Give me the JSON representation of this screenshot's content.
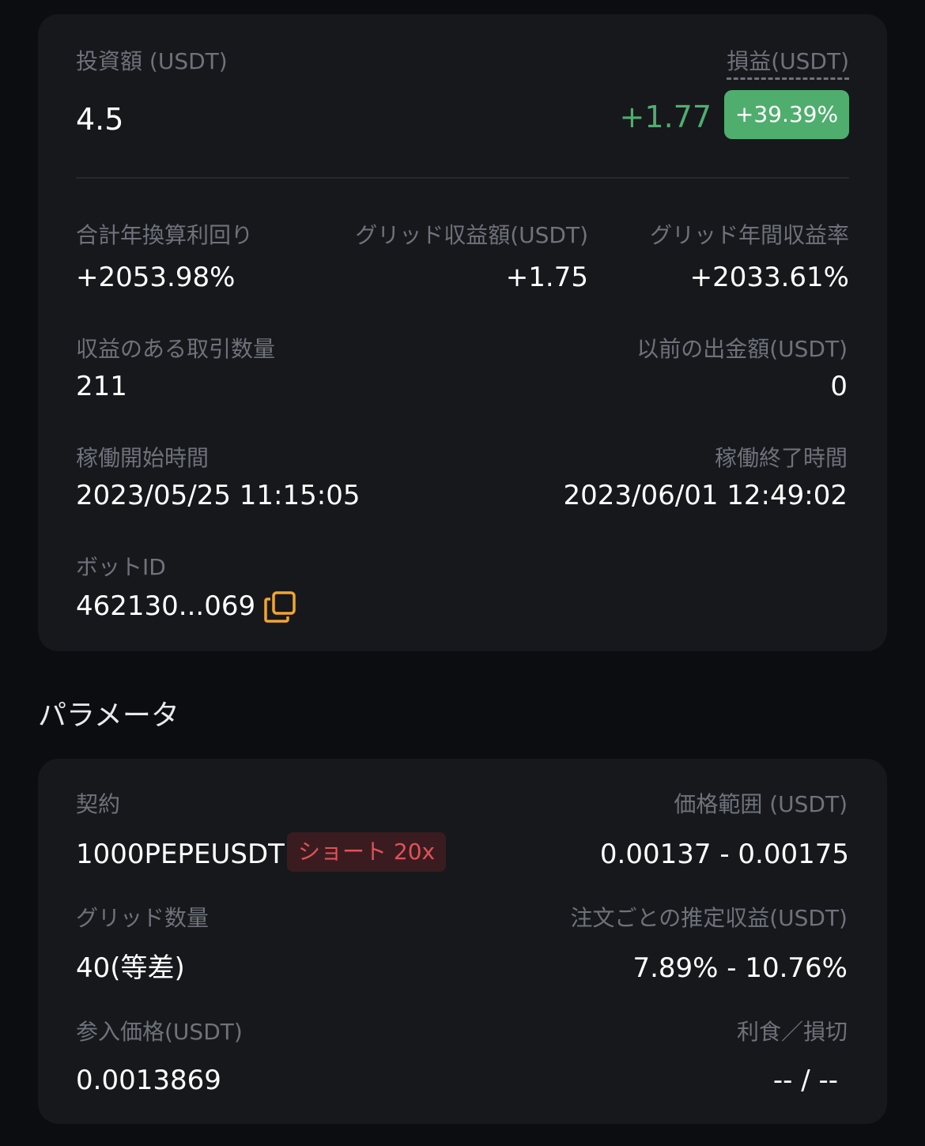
{
  "summary": {
    "investment": {
      "label": "投資額 (USDT)",
      "value": "4.5"
    },
    "pnl": {
      "label": "損益(USDT)",
      "value": "+1.77",
      "percent": "+39.39%"
    },
    "annual_yield": {
      "label": "合計年換算利回り",
      "value": "+2053.98%"
    },
    "grid_profit": {
      "label": "グリッド収益額(USDT)",
      "value": "+1.75"
    },
    "grid_annual_rate": {
      "label": "グリッド年間収益率",
      "value": "+2033.61%"
    },
    "profitable_trades": {
      "label": "収益のある取引数量",
      "value": "211"
    },
    "prev_withdraw": {
      "label": "以前の出金額(USDT)",
      "value": "0"
    },
    "start_time": {
      "label": "稼働開始時間",
      "value": "2023/05/25 11:15:05"
    },
    "end_time": {
      "label": "稼働終了時間",
      "value": "2023/06/01 12:49:02"
    },
    "bot_id": {
      "label": "ボットID",
      "value": "462130...069"
    }
  },
  "params_title": "パラメータ",
  "params": {
    "contract": {
      "label": "契約",
      "value": "1000PEPEUSDT",
      "tag": "ショート 20x"
    },
    "price_range": {
      "label": "価格範囲 (USDT)",
      "value": "0.00137 - 0.00175"
    },
    "grid_count": {
      "label": "グリッド数量",
      "value": "40(等差)"
    },
    "est_profit": {
      "label": "注文ごとの推定収益(USDT)",
      "value": "7.89% - 10.76%"
    },
    "entry_price": {
      "label": "参入価格(USDT)",
      "value": "0.0013869"
    },
    "tp_sl": {
      "label": "利食／損切",
      "value": "-- / --"
    }
  },
  "colors": {
    "profit": "#4fae6e",
    "short": "#e05257",
    "accent_icon": "#f0a630"
  },
  "icons": {
    "copy": "copy-icon"
  }
}
